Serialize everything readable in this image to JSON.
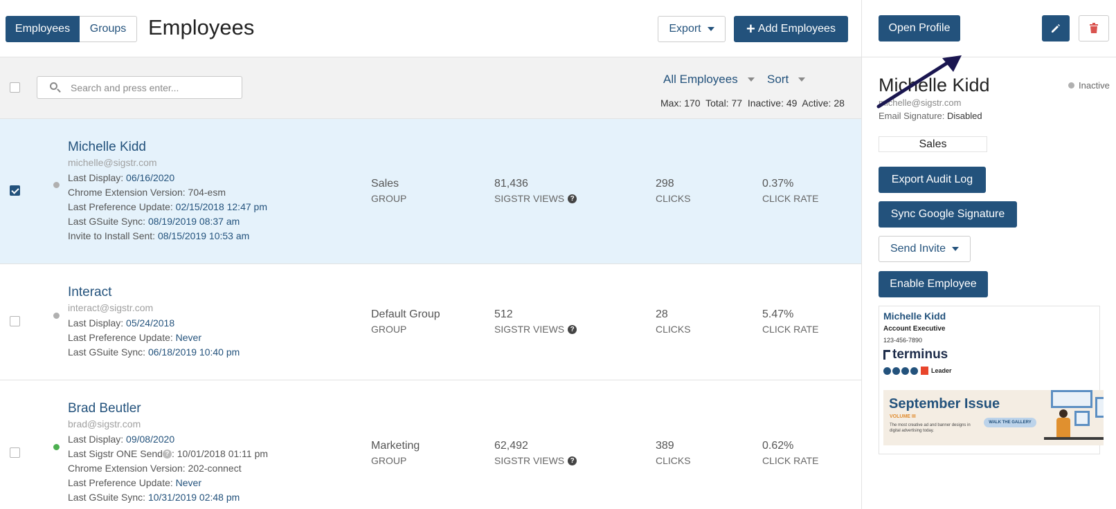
{
  "header": {
    "tabs": [
      {
        "label": "Employees",
        "active": true
      },
      {
        "label": "Groups",
        "active": false
      }
    ],
    "title": "Employees",
    "export_label": "Export",
    "add_label": "Add Employees"
  },
  "filters": {
    "search_placeholder": "Search and press enter...",
    "all_employees_label": "All Employees",
    "sort_label": "Sort",
    "stats": "Max: 170  Total: 77  Inactive: 49  Active: 28"
  },
  "employees": [
    {
      "name": "Michelle Kidd",
      "email": "michelle@sigstr.com",
      "selected": true,
      "status_color": "#b0b0b0",
      "details": [
        {
          "label": "Last Display: ",
          "value": "06/16/2020"
        },
        {
          "label": "Chrome Extension Version: 704-esm",
          "value": ""
        },
        {
          "label": "Last Preference Update: ",
          "value": "02/15/2018 12:47 pm"
        },
        {
          "label": "Last GSuite Sync: ",
          "value": "08/19/2019 08:37 am"
        },
        {
          "label": "Invite to Install Sent: ",
          "value": "08/15/2019 10:53 am"
        }
      ],
      "group": "Sales",
      "group_label": "GROUP",
      "views": "81,436",
      "views_label": "SIGSTR VIEWS",
      "clicks": "298",
      "clicks_label": "CLICKS",
      "rate": "0.37%",
      "rate_label": "CLICK RATE"
    },
    {
      "name": "Interact",
      "email": "interact@sigstr.com",
      "selected": false,
      "status_color": "#b0b0b0",
      "details": [
        {
          "label": "Last Display: ",
          "value": "05/24/2018"
        },
        {
          "label": "Last Preference Update: ",
          "value": "Never"
        },
        {
          "label": "Last GSuite Sync: ",
          "value": "06/18/2019 10:40 pm"
        }
      ],
      "group": "Default Group",
      "group_label": "GROUP",
      "views": "512",
      "views_label": "SIGSTR VIEWS",
      "clicks": "28",
      "clicks_label": "CLICKS",
      "rate": "5.47%",
      "rate_label": "CLICK RATE"
    },
    {
      "name": "Brad Beutler",
      "email": "brad@sigstr.com",
      "selected": false,
      "status_color": "#4caf50",
      "details": [
        {
          "label": "Last Display: ",
          "value": "09/08/2020"
        },
        {
          "label": "Last Sigstr ONE Send ",
          "value": ""
        },
        {
          "label": "Chrome Extension Version: 202-connect",
          "value": ""
        },
        {
          "label": "Last Preference Update: ",
          "value": "Never"
        },
        {
          "label": "Last GSuite Sync: ",
          "value": "10/31/2019 02:48 pm"
        }
      ],
      "sigstr_one_suffix": ": 10/01/2018 01:11 pm",
      "group": "Marketing",
      "group_label": "GROUP",
      "views": "62,492",
      "views_label": "SIGSTR VIEWS",
      "clicks": "389",
      "clicks_label": "CLICKS",
      "rate": "0.62%",
      "rate_label": "CLICK RATE"
    }
  ],
  "profile": {
    "open_profile_label": "Open Profile",
    "name": "Michelle Kidd",
    "email": "michelle@sigstr.com",
    "status": "Inactive",
    "signature_label": "Email Signature: ",
    "signature_value": "Disabled",
    "group": "Sales",
    "export_audit_label": "Export Audit Log",
    "sync_google_label": "Sync Google Signature",
    "send_invite_label": "Send Invite",
    "enable_label": "Enable Employee",
    "signature_preview": {
      "name": "Michelle Kidd",
      "title": "Account Executive",
      "phone": "123-456-7890",
      "logo": "terminus",
      "leader": "Leader",
      "banner_title": "September Issue",
      "banner_volume": "VOLUME III",
      "banner_text": "The most creative ad and banner designs in digital advertising today.",
      "banner_cta": "WALK THE GALLERY"
    }
  }
}
